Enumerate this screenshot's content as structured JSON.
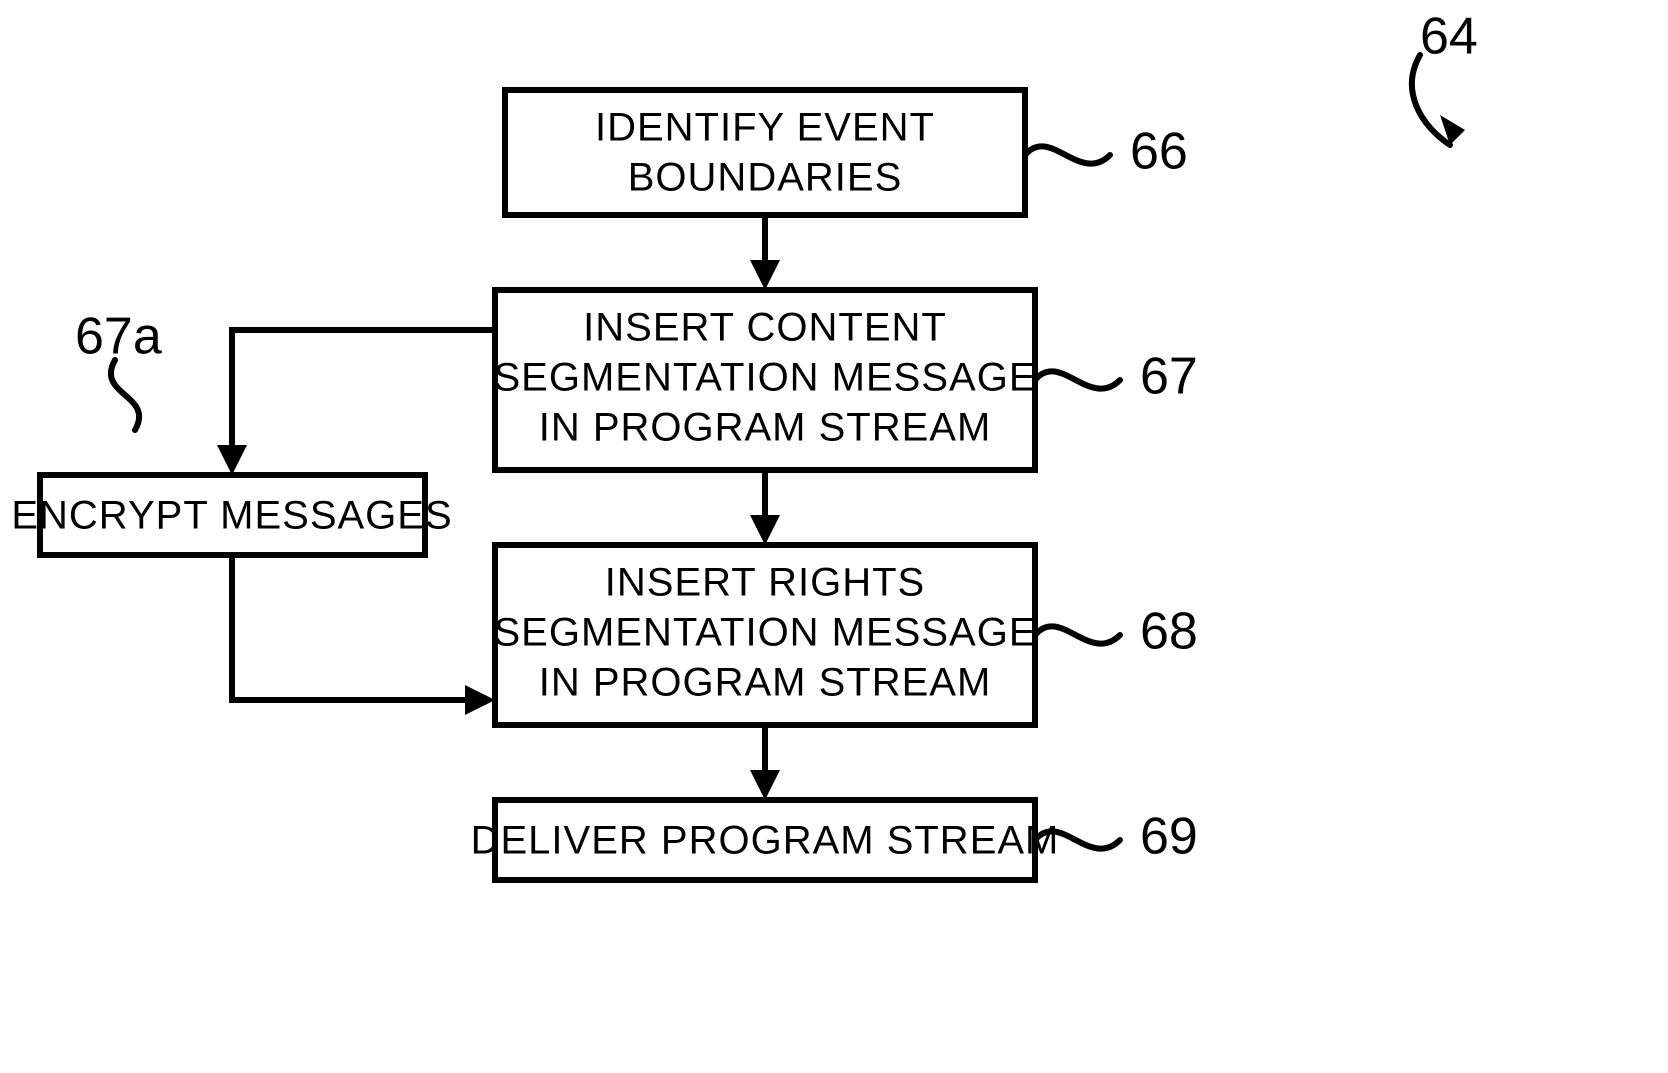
{
  "diagram": {
    "ref_main": "64",
    "nodes": {
      "identify": {
        "line1": "IDENTIFY EVENT",
        "line2": "BOUNDARIES",
        "ref": "66"
      },
      "insert_content": {
        "line1": "INSERT CONTENT",
        "line2": "SEGMENTATION MESSAGE",
        "line3": "IN PROGRAM STREAM",
        "ref": "67"
      },
      "encrypt": {
        "line1": "ENCRYPT MESSAGES",
        "ref": "67a"
      },
      "insert_rights": {
        "line1": "INSERT RIGHTS",
        "line2": "SEGMENTATION MESSAGE",
        "line3": "IN PROGRAM STREAM",
        "ref": "68"
      },
      "deliver": {
        "line1": "DELIVER PROGRAM STREAM",
        "ref": "69"
      }
    }
  }
}
